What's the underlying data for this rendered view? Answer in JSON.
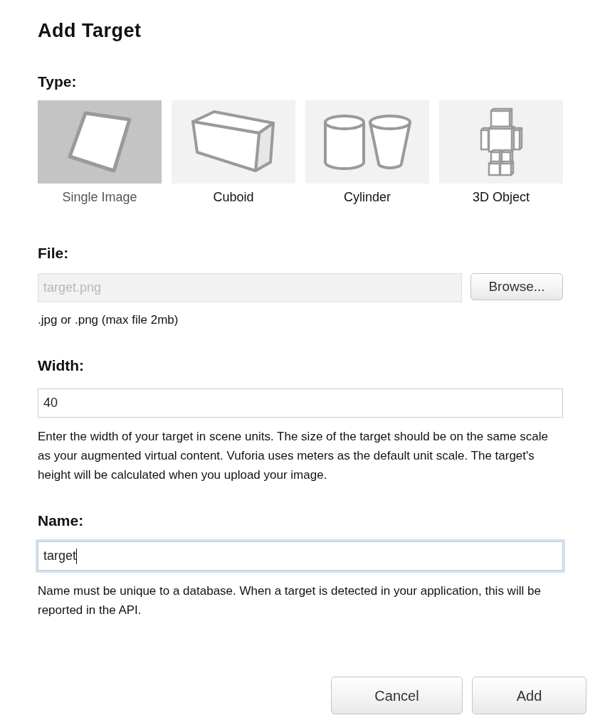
{
  "dialog": {
    "title": "Add Target"
  },
  "type": {
    "label": "Type:",
    "options": [
      {
        "label": "Single Image",
        "selected": true
      },
      {
        "label": "Cuboid",
        "selected": false
      },
      {
        "label": "Cylinder",
        "selected": false
      },
      {
        "label": "3D Object",
        "selected": false
      }
    ]
  },
  "file": {
    "label": "File:",
    "field": {
      "value": "target.png",
      "disabled": true,
      "focused": false
    },
    "browse_button": "Browse...",
    "hint": ".jpg or .png (max file 2mb)"
  },
  "width": {
    "label": "Width:",
    "field": {
      "value": "40",
      "disabled": false,
      "focused": false
    },
    "help": "Enter the width of your target in scene units. The size of the target should be on the same scale as your augmented virtual content. Vuforia uses meters as the default unit scale. The target's height will be calculated when you upload your image."
  },
  "name": {
    "label": "Name:",
    "field": {
      "value": "target",
      "disabled": false,
      "focused": true
    },
    "help": "Name must be unique to a database. When a target is detected in your application, this will be reported in the API."
  },
  "buttons": [
    "Cancel",
    "Add"
  ]
}
